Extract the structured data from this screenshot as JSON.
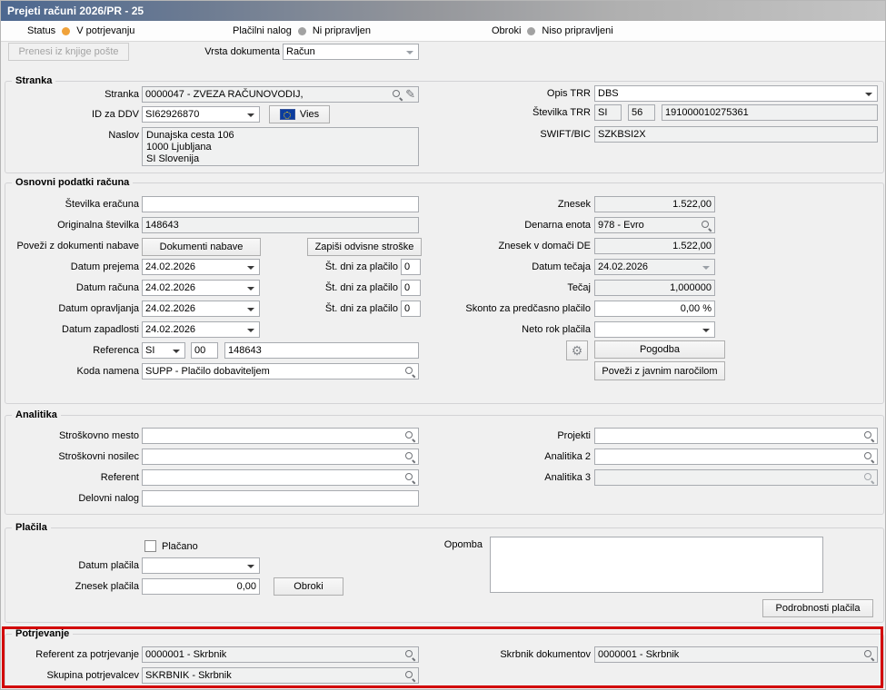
{
  "titlebar": {
    "title": "Prejeti računi 2026/PR - 25"
  },
  "statusbar": {
    "status_label": "Status",
    "status_value": "V potrjevanju",
    "status_dot_color": "#f0a23a",
    "payment_label": "Plačilni nalog",
    "payment_value": "Ni pripravljen",
    "payment_dot_color": "#a2a2a2",
    "installments_label": "Obroki",
    "installments_value": "Niso pripravljeni",
    "installments_dot_color": "#a2a2a2"
  },
  "toolbar": {
    "transfer_button": "Prenesi iz knjige pošte",
    "doc_type_label": "Vrsta dokumenta",
    "doc_type_value": "Račun"
  },
  "stranka": {
    "group_title": "Stranka",
    "stranka_label": "Stranka",
    "stranka_value": "0000047 - ZVEZA RAČUNOVODIJ,",
    "id_ddv_label": "ID za DDV",
    "id_ddv_value": "SI62926870",
    "vies_button": "Vies",
    "naslov_label": "Naslov",
    "naslov_lines": [
      "Dunajska cesta 106",
      "1000 Ljubljana",
      "SI Slovenija"
    ],
    "opis_trr_label": "Opis TRR",
    "opis_trr_value": "DBS",
    "stevilka_trr_label": "Številka TRR",
    "trr_country": "SI",
    "trr_check": "56",
    "trr_number": "191000010275361",
    "swift_label": "SWIFT/BIC",
    "swift_value": "SZKBSI2X"
  },
  "osnovni": {
    "group_title": "Osnovni podatki računa",
    "eracun_label": "Številka eračuna",
    "eracun_value": "",
    "orig_label": "Originalna številka",
    "orig_value": "148643",
    "povezi_label": "Poveži z dokumenti nabave",
    "dokumenti_button": "Dokumenti nabave",
    "odvisni_button": "Zapiši odvisne stroške",
    "datum_prejema_label": "Datum prejema",
    "datum_prejema_value": "24.02.2026",
    "datum_racuna_label": "Datum računa",
    "datum_racuna_value": "24.02.2026",
    "datum_opravljanja_label": "Datum opravljanja",
    "datum_opravljanja_value": "24.02.2026",
    "datum_zapadlosti_label": "Datum zapadlosti",
    "datum_zapadlosti_value": "24.02.2026",
    "st_dni_label_1": "Št. dni za plačilo",
    "st_dni_value_1": "0",
    "st_dni_label_2": "Št. dni za plačilo",
    "st_dni_value_2": "0",
    "st_dni_label_3": "Št. dni za plačilo",
    "st_dni_value_3": "0",
    "referenca_label": "Referenca",
    "ref_model": "SI",
    "ref_check": "00",
    "ref_number": "148643",
    "koda_label": "Koda namena",
    "koda_value": "SUPP - Plačilo dobaviteljem",
    "znesek_label": "Znesek",
    "znesek_value": "1.522,00",
    "denarna_label": "Denarna enota",
    "denarna_value": "978 - Evro",
    "znesek_de_label": "Znesek v domači DE",
    "znesek_de_value": "1.522,00",
    "datum_tecaja_label": "Datum tečaja",
    "datum_tecaja_value": "24.02.2026",
    "tecaj_label": "Tečaj",
    "tecaj_value": "1,000000",
    "skonto_label": "Skonto za predčasno plačilo",
    "skonto_value": "0,00 %",
    "neto_label": "Neto rok plačila",
    "neto_value": "",
    "pogodba_button": "Pogodba",
    "javno_button": "Poveži z javnim naročilom"
  },
  "analitika": {
    "group_title": "Analitika",
    "sm_label": "Stroškovno mesto",
    "sm_value": "",
    "sn_label": "Stroškovni nosilec",
    "sn_value": "",
    "referent_label": "Referent",
    "referent_value": "",
    "dn_label": "Delovni nalog",
    "dn_value": "",
    "projekti_label": "Projekti",
    "projekti_value": "",
    "a2_label": "Analitika 2",
    "a2_value": "",
    "a3_label": "Analitika 3",
    "a3_value": ""
  },
  "placila": {
    "group_title": "Plačila",
    "placano_label": "Plačano",
    "placano_checked": false,
    "datum_placila_label": "Datum plačila",
    "datum_placila_value": "",
    "znesek_placila_label": "Znesek plačila",
    "znesek_placila_value": "0,00",
    "obroki_button": "Obroki",
    "opomba_label": "Opomba",
    "opomba_value": "",
    "podrobnosti_button": "Podrobnosti plačila"
  },
  "potrjevanje": {
    "group_title": "Potrjevanje",
    "referent_label": "Referent za potrjevanje",
    "referent_value": "0000001 - Skrbnik",
    "skupina_label": "Skupina potrjevalcev",
    "skupina_value": "SKRBNIK - Skrbnik",
    "skrbnik_label": "Skrbnik dokumentov",
    "skrbnik_value": "0000001 - Skrbnik"
  },
  "icons": [
    "search-icon",
    "edit-pencil-icon",
    "dropdown-arrow-icon",
    "eu-flag-icon",
    "gear-link-icon",
    "status-dot"
  ],
  "colors": {
    "highlight_border": "#d20000",
    "status_active": "#f0a23a",
    "status_inactive": "#a2a2a2",
    "titlebar_left": "#4d6890"
  }
}
